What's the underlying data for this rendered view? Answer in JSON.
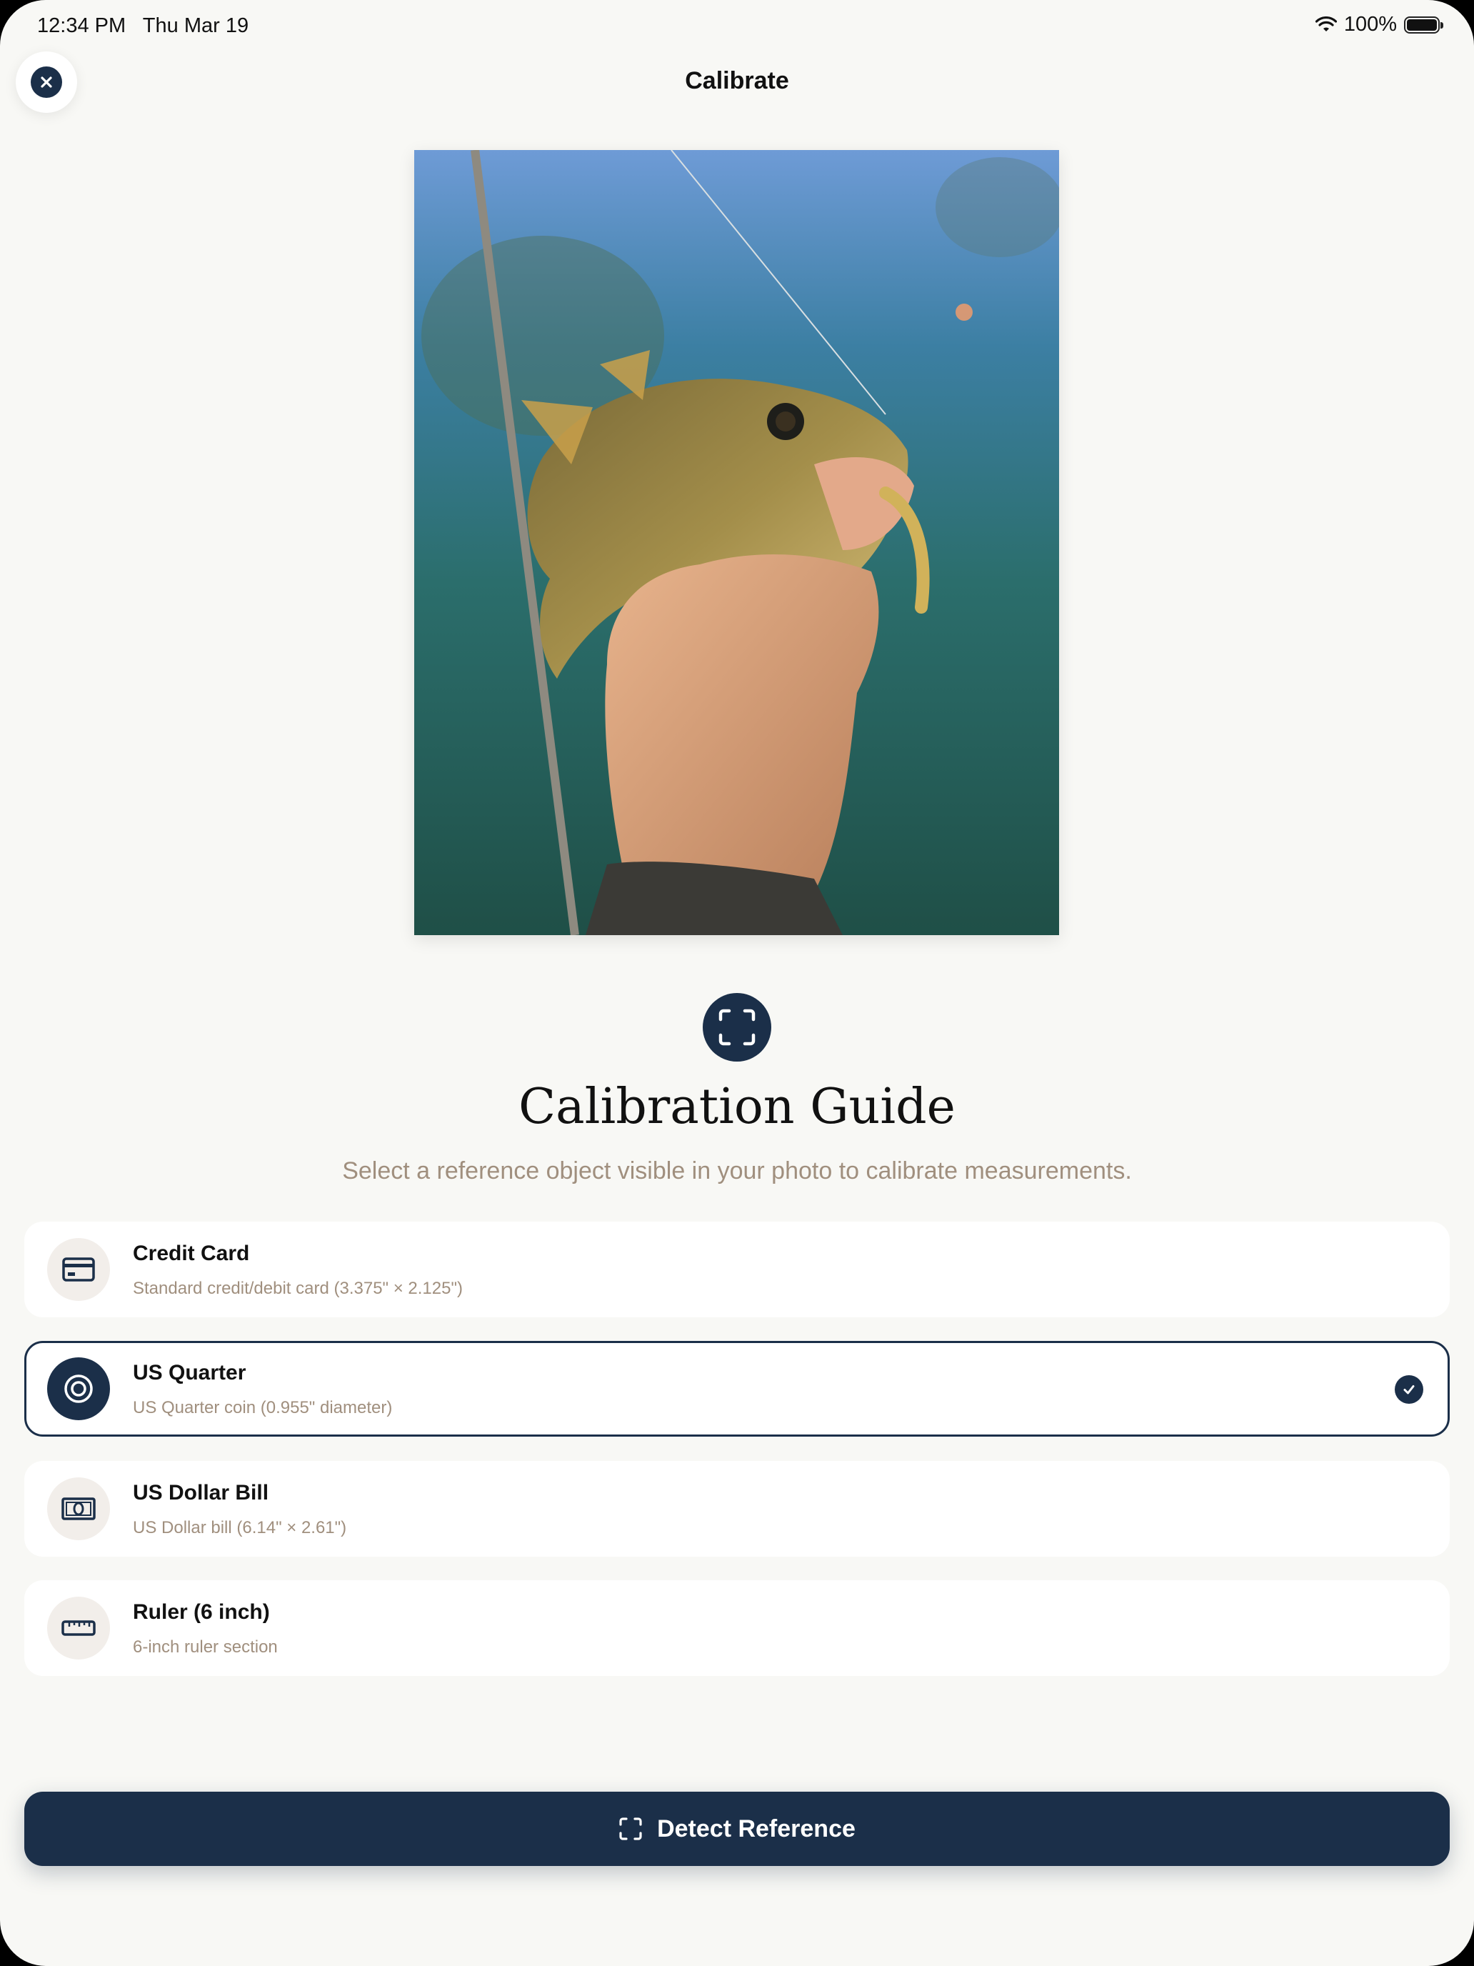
{
  "status_bar": {
    "time": "12:34 PM",
    "date": "Thu Mar 19",
    "battery": "100%"
  },
  "header": {
    "title": "Calibrate",
    "close_icon": "close-icon"
  },
  "photo": {
    "subject": "photo-of-fish"
  },
  "guide": {
    "icon": "viewfinder-icon",
    "title": "Calibration Guide",
    "subtitle": "Select a reference object visible in your photo to calibrate measurements."
  },
  "options": [
    {
      "title": "Credit Card",
      "desc": "Standard credit/debit card (3.375\" × 2.125\")",
      "icon": "credit-card-icon",
      "selected": false
    },
    {
      "title": "US Quarter",
      "desc": "US Quarter coin (0.955\" diameter)",
      "icon": "coin-icon",
      "selected": true
    },
    {
      "title": "US Dollar Bill",
      "desc": "US Dollar bill (6.14\" × 2.61\")",
      "icon": "dollar-bill-icon",
      "selected": false
    },
    {
      "title": "Ruler (6 inch)",
      "desc": "6-inch ruler section",
      "icon": "ruler-icon",
      "selected": false
    }
  ],
  "detect_button": {
    "label": "Detect Reference",
    "icon": "viewfinder-icon"
  },
  "colors": {
    "accent": "#1B2F49",
    "muted_text": "#A08F7E",
    "background": "#F8F8F5"
  }
}
